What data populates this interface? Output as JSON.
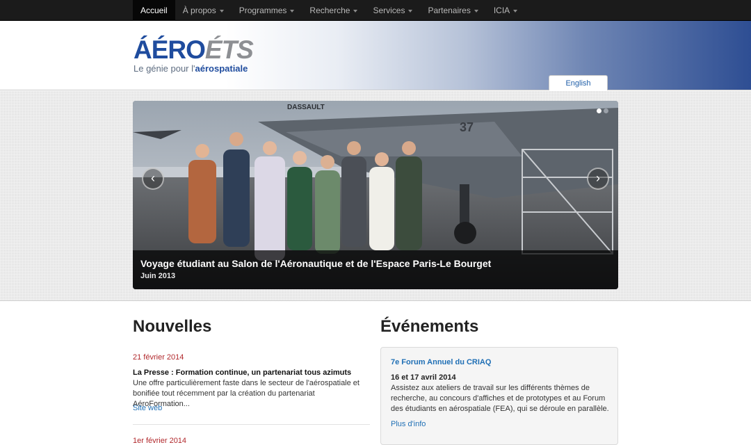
{
  "nav": {
    "items": [
      {
        "label": "Accueil",
        "active": true,
        "dropdown": false
      },
      {
        "label": "À propos",
        "dropdown": true
      },
      {
        "label": "Programmes",
        "dropdown": true
      },
      {
        "label": "Recherche",
        "dropdown": true
      },
      {
        "label": "Services",
        "dropdown": true
      },
      {
        "label": "Partenaires",
        "dropdown": true
      },
      {
        "label": "ICIA",
        "dropdown": true
      }
    ]
  },
  "header": {
    "logo_aero": "ÁÉRO",
    "logo_ets": "ÉTS",
    "logo_tagline_prefix": "Le génie pour l'",
    "logo_tagline_bold": "aérospatiale",
    "lang_label": "English",
    "gradient_colors": [
      "#ffffff",
      "#2e4e93"
    ]
  },
  "carousel": {
    "caption_title": "Voyage étudiant au Salon de l'Aéronautique et de l'Espace Paris-Le Bourget",
    "caption_date": "Juin 2013",
    "prev_icon": "chevron-left-icon",
    "next_icon": "chevron-right-icon",
    "slide_count": 2,
    "active_slide": 1,
    "photo_jet_text": "DASSAULT",
    "photo_jet_number": "37"
  },
  "news": {
    "heading": "Nouvelles",
    "items": [
      {
        "date": "21 février 2014",
        "title": "La Presse : Formation continue, un partenariat tous azimuts",
        "text": "Une offre particulièrement faste dans le secteur de l'aérospatiale et bonifiée tout récemment par la création du partenariat AéroFormation...",
        "link": "Site web"
      },
      {
        "date": "1er février 2014"
      }
    ]
  },
  "events": {
    "heading": "Événements",
    "items": [
      {
        "title": "7e Forum Annuel du CRIAQ",
        "date": "16 et 17 avril 2014",
        "text": "Assistez aux ateliers de travail sur les différents thèmes de recherche, au concours d'affiches et de prototypes et au Forum des étudiants en aérospatiale (FEA), qui se déroule en parallèle.",
        "link": "Plus d'info"
      }
    ]
  },
  "colors": {
    "nav_bg": "#1b1b1b",
    "brand_blue": "#1f4c9e",
    "link_blue": "#1f6fb5",
    "date_red": "#b1282c"
  }
}
